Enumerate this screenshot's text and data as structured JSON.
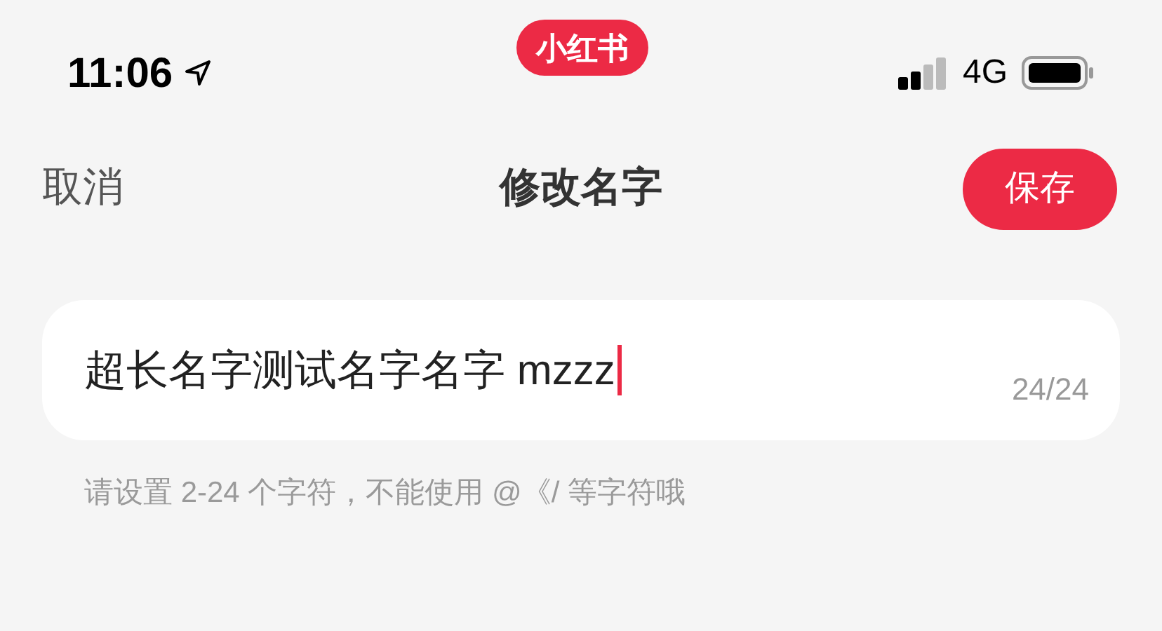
{
  "status_bar": {
    "time": "11:06",
    "network": "4G"
  },
  "app_badge": {
    "label": "小红书"
  },
  "nav": {
    "cancel": "取消",
    "title": "修改名字",
    "save": "保存"
  },
  "name_field": {
    "value": "超长名字测试名字名字 mzzz",
    "counter": "24/24"
  },
  "hint": "请设置 2-24 个字符，不能使用 @《/ 等字符哦"
}
